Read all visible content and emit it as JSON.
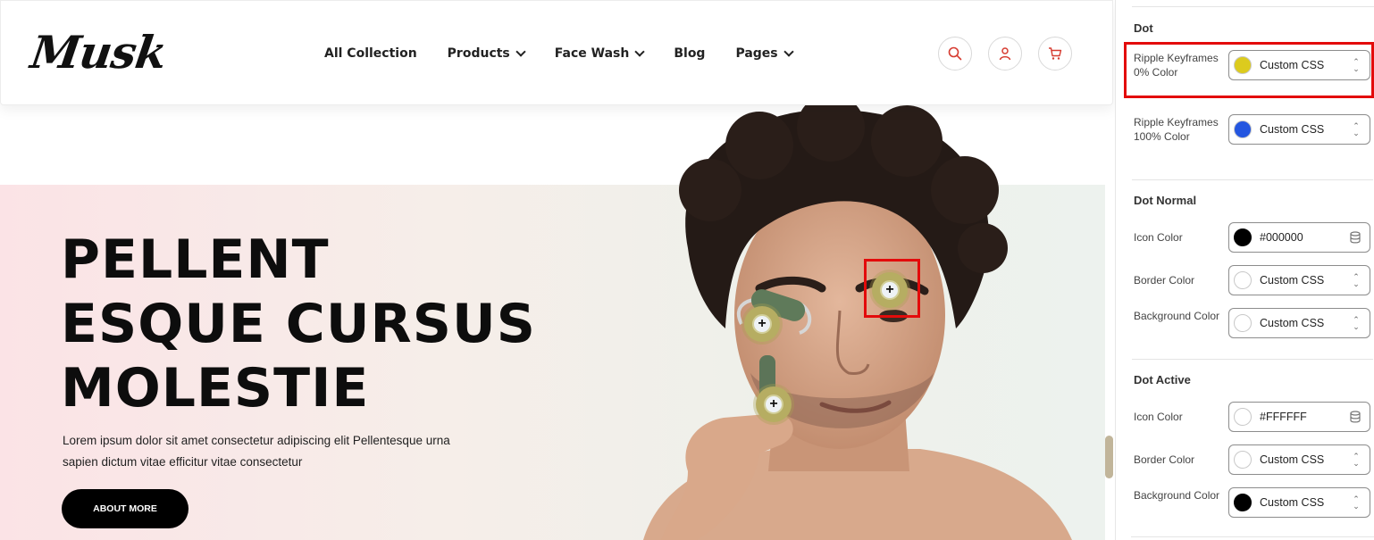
{
  "preview": {
    "logo": "Musk",
    "nav": [
      {
        "label": "All Collection",
        "dropdown": false
      },
      {
        "label": "Products",
        "dropdown": true
      },
      {
        "label": "Face Wash",
        "dropdown": true
      },
      {
        "label": "Blog",
        "dropdown": false
      },
      {
        "label": "Pages",
        "dropdown": true
      }
    ],
    "icons": [
      "search-icon",
      "user-icon",
      "cart-icon"
    ],
    "accent_color": "#d63a2f",
    "hero": {
      "title_lines": [
        "PELLENT",
        "ESQUE CURSUS",
        "MOLESTIE"
      ],
      "text": "Lorem ipsum dolor sit amet consectetur adipiscing elit Pellentesque urna sapien dictum vitae efficitur vitae consectetur",
      "button": "ABOUT MORE"
    },
    "hotspot_symbol": "+"
  },
  "panel": {
    "sections": {
      "dot": "Dot",
      "dot_normal": "Dot Normal",
      "dot_active": "Dot Active"
    },
    "rows": {
      "ripple_0": {
        "label": "Ripple Keyframes 0% Color",
        "value": "Custom CSS",
        "color": "#dccb1e"
      },
      "ripple_100": {
        "label": "Ripple Keyframes 100% Color",
        "value": "Custom CSS",
        "color": "#2456e0"
      },
      "normal_icon": {
        "label": "Icon Color",
        "value": "#000000",
        "color": "#000000"
      },
      "normal_border": {
        "label": "Border Color",
        "value": "Custom CSS",
        "color": "#ffffff"
      },
      "normal_bg": {
        "label": "Background Color",
        "value": "Custom CSS",
        "color": "#ffffff"
      },
      "active_icon": {
        "label": "Icon Color",
        "value": "#FFFFFF",
        "color": "#ffffff"
      },
      "active_border": {
        "label": "Border Color",
        "value": "Custom CSS",
        "color": "#ffffff"
      },
      "active_bg": {
        "label": "Background Color",
        "value": "Custom CSS",
        "color": "#000000"
      }
    },
    "highlight_color": "#e30b0b"
  }
}
